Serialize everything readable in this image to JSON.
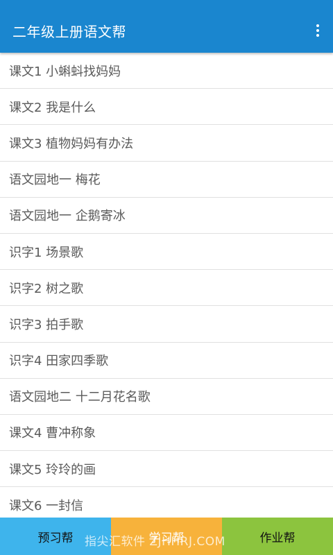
{
  "appbar": {
    "title": "二年级上册语文帮",
    "menu_icon": "more-vert-icon",
    "color": "#1a86cf"
  },
  "lessons": [
    "课文1 小蝌蚪找妈妈",
    "课文2 我是什么",
    "课文3 植物妈妈有办法",
    "语文园地一 梅花",
    "语文园地一 企鹅寄冰",
    "识字1 场景歌",
    "识字2 树之歌",
    "识字3 拍手歌",
    "识字4 田家四季歌",
    "语文园地二 十二月花名歌",
    "课文4 曹冲称象",
    "课文5 玲玲的画",
    "课文6 一封信"
  ],
  "tabs": [
    {
      "label": "预习帮",
      "color": "#3eb4ec"
    },
    {
      "label": "学习帮",
      "color": "#f7b23b"
    },
    {
      "label": "作业帮",
      "color": "#8cc43e"
    }
  ],
  "watermark": "指尖汇软件 ZJHHRJ.COM"
}
